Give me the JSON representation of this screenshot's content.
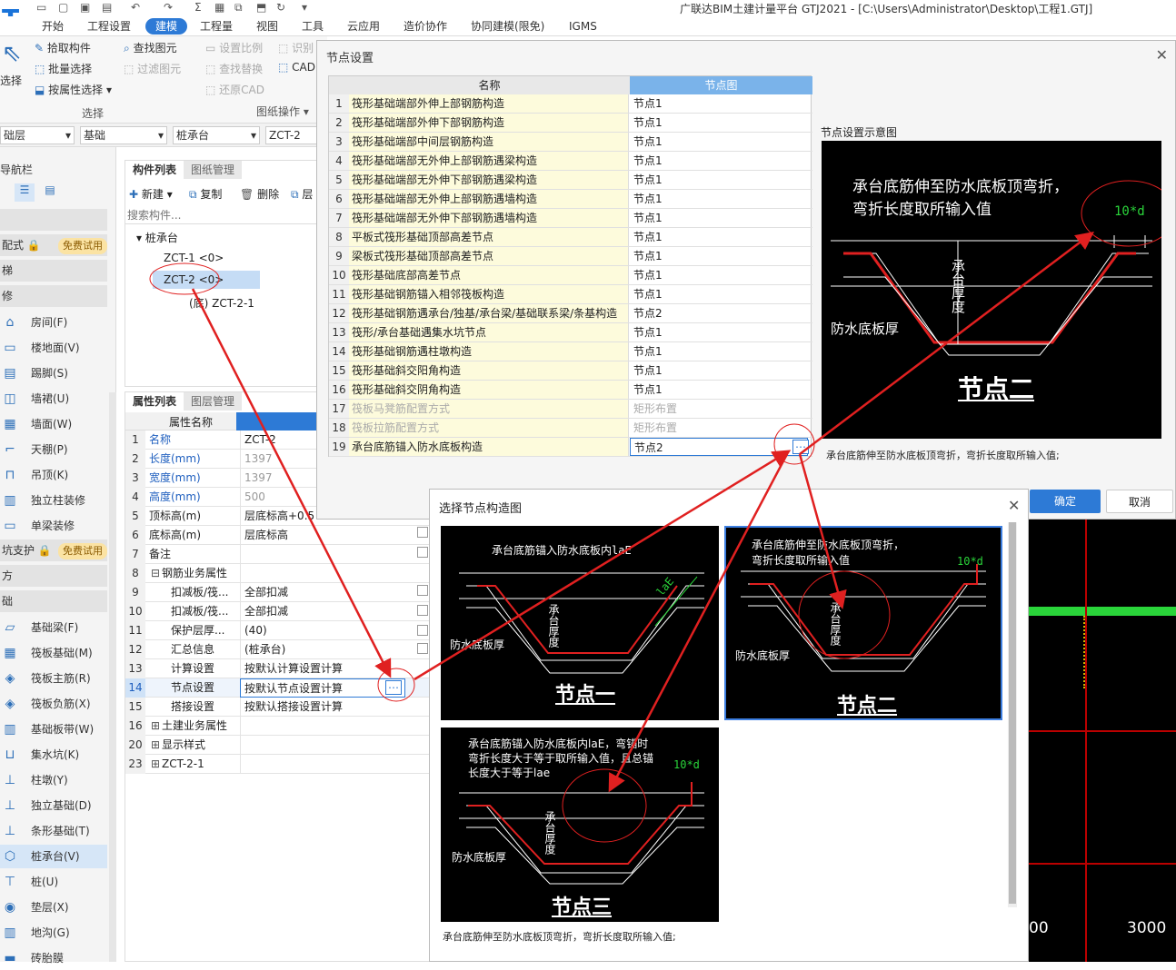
{
  "app": {
    "title": "广联达BIM土建计量平台 GTJ2021 - [C:\\Users\\Administrator\\Desktop\\工程1.GTJ]",
    "menu_tabs": [
      "开始",
      "工程设置",
      "建模",
      "工程量",
      "视图",
      "工具",
      "云应用",
      "造价协作",
      "协同建模(限免)",
      "IGMS"
    ],
    "active_tab": "建模"
  },
  "ribbon": {
    "select_label": "选择",
    "pick": "拾取构件",
    "batch": "批量选择",
    "by_attr": "按属性选择",
    "find": "查找图元",
    "filter": "过滤图元",
    "set_scale": "设置比例",
    "identify": "识别",
    "find_replace": "查找替换",
    "cad": "CAD",
    "restore_cad": "还原CAD",
    "group_select": "选择",
    "group_drawing": "图纸操作"
  },
  "selectors": {
    "floor": "础层",
    "type": "基础",
    "category": "桩承台",
    "component": "ZCT-2"
  },
  "leftnav": {
    "header": "导航栏",
    "free_trial": "免费试用",
    "sections": [
      "配式",
      "梯",
      "修",
      "坑支护",
      "方",
      "础"
    ],
    "items": [
      "房间(F)",
      "楼地面(V)",
      "踢脚(S)",
      "墙裙(U)",
      "墙面(W)",
      "天棚(P)",
      "吊顶(K)",
      "独立柱装修",
      "单梁装修",
      "基础梁(F)",
      "筏板基础(M)",
      "筏板主筋(R)",
      "筏板负筋(X)",
      "基础板带(W)",
      "集水坑(K)",
      "柱墩(Y)",
      "独立基础(D)",
      "条形基础(T)",
      "桩承台(V)",
      "桩(U)",
      "垫层(X)",
      "地沟(G)",
      "砖胎膜"
    ]
  },
  "complist": {
    "tab1": "构件列表",
    "tab2": "图纸管理",
    "new": "新建",
    "copy": "复制",
    "delete": "删除",
    "layer": "层",
    "search_placeholder": "搜索构件...",
    "tree_root": "桩承台",
    "tree_items": [
      "ZCT-1 <0>",
      "ZCT-2 <0>",
      "(底) ZCT-2-1"
    ]
  },
  "props": {
    "tab1": "属性列表",
    "tab2": "图层管理",
    "col_name": "属性名称",
    "col_value": "属",
    "rows": [
      {
        "n": "1",
        "k": "名称",
        "v": "ZCT-2"
      },
      {
        "n": "2",
        "k": "长度(mm)",
        "v": "1397"
      },
      {
        "n": "3",
        "k": "宽度(mm)",
        "v": "1397"
      },
      {
        "n": "4",
        "k": "高度(mm)",
        "v": "500"
      },
      {
        "n": "5",
        "k": "顶标高(m)",
        "v": "层底标高+0.5"
      },
      {
        "n": "6",
        "k": "底标高(m)",
        "v": "层底标高"
      },
      {
        "n": "7",
        "k": "备注",
        "v": ""
      },
      {
        "n": "8",
        "k": "钢筋业务属性",
        "v": ""
      },
      {
        "n": "9",
        "k": "扣减板/筏...",
        "v": "全部扣减"
      },
      {
        "n": "10",
        "k": "扣减板/筏...",
        "v": "全部扣减"
      },
      {
        "n": "11",
        "k": "保护层厚...",
        "v": "(40)"
      },
      {
        "n": "12",
        "k": "汇总信息",
        "v": "(桩承台)"
      },
      {
        "n": "13",
        "k": "计算设置",
        "v": "按默认计算设置计算"
      },
      {
        "n": "14",
        "k": "节点设置",
        "v": "按默认节点设置计算"
      },
      {
        "n": "15",
        "k": "搭接设置",
        "v": "按默认搭接设置计算"
      },
      {
        "n": "16",
        "k": "土建业务属性",
        "v": ""
      },
      {
        "n": "20",
        "k": "显示样式",
        "v": ""
      },
      {
        "n": "23",
        "k": "ZCT-2-1",
        "v": ""
      }
    ]
  },
  "dlg1": {
    "title": "节点设置",
    "col_name": "名称",
    "col_node": "节点图",
    "preview_title": "节点设置示意图",
    "rows": [
      {
        "n": "1",
        "k": "筏形基础端部外伸上部钢筋构造",
        "v": "节点1"
      },
      {
        "n": "2",
        "k": "筏形基础端部外伸下部钢筋构造",
        "v": "节点1"
      },
      {
        "n": "3",
        "k": "筏形基础端部中间层钢筋构造",
        "v": "节点1"
      },
      {
        "n": "4",
        "k": "筏形基础端部无外伸上部钢筋遇梁构造",
        "v": "节点1"
      },
      {
        "n": "5",
        "k": "筏形基础端部无外伸下部钢筋遇梁构造",
        "v": "节点1"
      },
      {
        "n": "6",
        "k": "筏形基础端部无外伸上部钢筋遇墙构造",
        "v": "节点1"
      },
      {
        "n": "7",
        "k": "筏形基础端部无外伸下部钢筋遇墙构造",
        "v": "节点1"
      },
      {
        "n": "8",
        "k": "平板式筏形基础顶部高差节点",
        "v": "节点1"
      },
      {
        "n": "9",
        "k": "梁板式筏形基础顶部高差节点",
        "v": "节点1"
      },
      {
        "n": "10",
        "k": "筏形基础底部高差节点",
        "v": "节点1"
      },
      {
        "n": "11",
        "k": "筏形基础钢筋锚入相邻筏板构造",
        "v": "节点1"
      },
      {
        "n": "12",
        "k": "筏形基础钢筋遇承台/独基/承台梁/基础联系梁/条基构造",
        "v": "节点2"
      },
      {
        "n": "13",
        "k": "筏形/承台基础遇集水坑节点",
        "v": "节点1"
      },
      {
        "n": "14",
        "k": "筏形基础钢筋遇柱墩构造",
        "v": "节点1"
      },
      {
        "n": "15",
        "k": "筏形基础斜交阳角构造",
        "v": "节点1"
      },
      {
        "n": "16",
        "k": "筏形基础斜交阴角构造",
        "v": "节点1"
      },
      {
        "n": "17",
        "k": "筏板马凳筋配置方式",
        "v": "矩形布置"
      },
      {
        "n": "18",
        "k": "筏板拉筋配置方式",
        "v": "矩形布置"
      },
      {
        "n": "19",
        "k": "承台底筋锚入防水底板构造",
        "v": "节点2"
      }
    ],
    "preview_text": "承台底筋伸至防水底板顶弯折，\n弯折长度取所输入值",
    "preview_dim": "10*d",
    "preview_thick": "承台厚度",
    "preview_wp": "防水底板厚",
    "preview_node": "节点二",
    "desc": "承台底筋伸至防水底板顶弯折，弯折长度取所输入值;",
    "ok": "确定",
    "cancel": "取消"
  },
  "dlg2": {
    "title": "选择节点构造图",
    "n1_text": "承台底筋锚入防水底板内laE",
    "n1_dim": "laE",
    "n1_name": "节点一",
    "n2_text": "承台底筋伸至防水底板顶弯折，\n弯折长度取所输入值",
    "n2_dim": "10*d",
    "n2_name": "节点二",
    "n3_text": "承台底筋锚入防水底板内laE，弯锚时\n弯折长度大于等于取所输入值，且总锚\n长度大于等于lae",
    "n3_dim": "10*d",
    "n3_name": "节点三",
    "thick": "承台厚度",
    "wp": "防水底板厚",
    "desc": "承台底筋伸至防水底板顶弯折，弯折长度取所输入值;"
  },
  "canvas": {
    "label_left": "00",
    "label_right": "3000"
  }
}
